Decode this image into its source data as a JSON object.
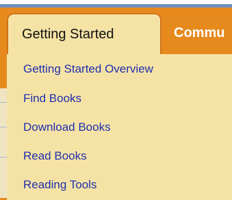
{
  "tabs": {
    "active_label": "Getting Started",
    "next_label": "Commu"
  },
  "dropdown": {
    "items": [
      {
        "label": "Getting Started Overview"
      },
      {
        "label": "Find Books"
      },
      {
        "label": "Download Books"
      },
      {
        "label": "Read Books"
      },
      {
        "label": "Reading Tools"
      }
    ]
  },
  "colors": {
    "tabbar": "#e78a1e",
    "menu_background": "#f5e3a6",
    "link": "#1f2fae"
  }
}
